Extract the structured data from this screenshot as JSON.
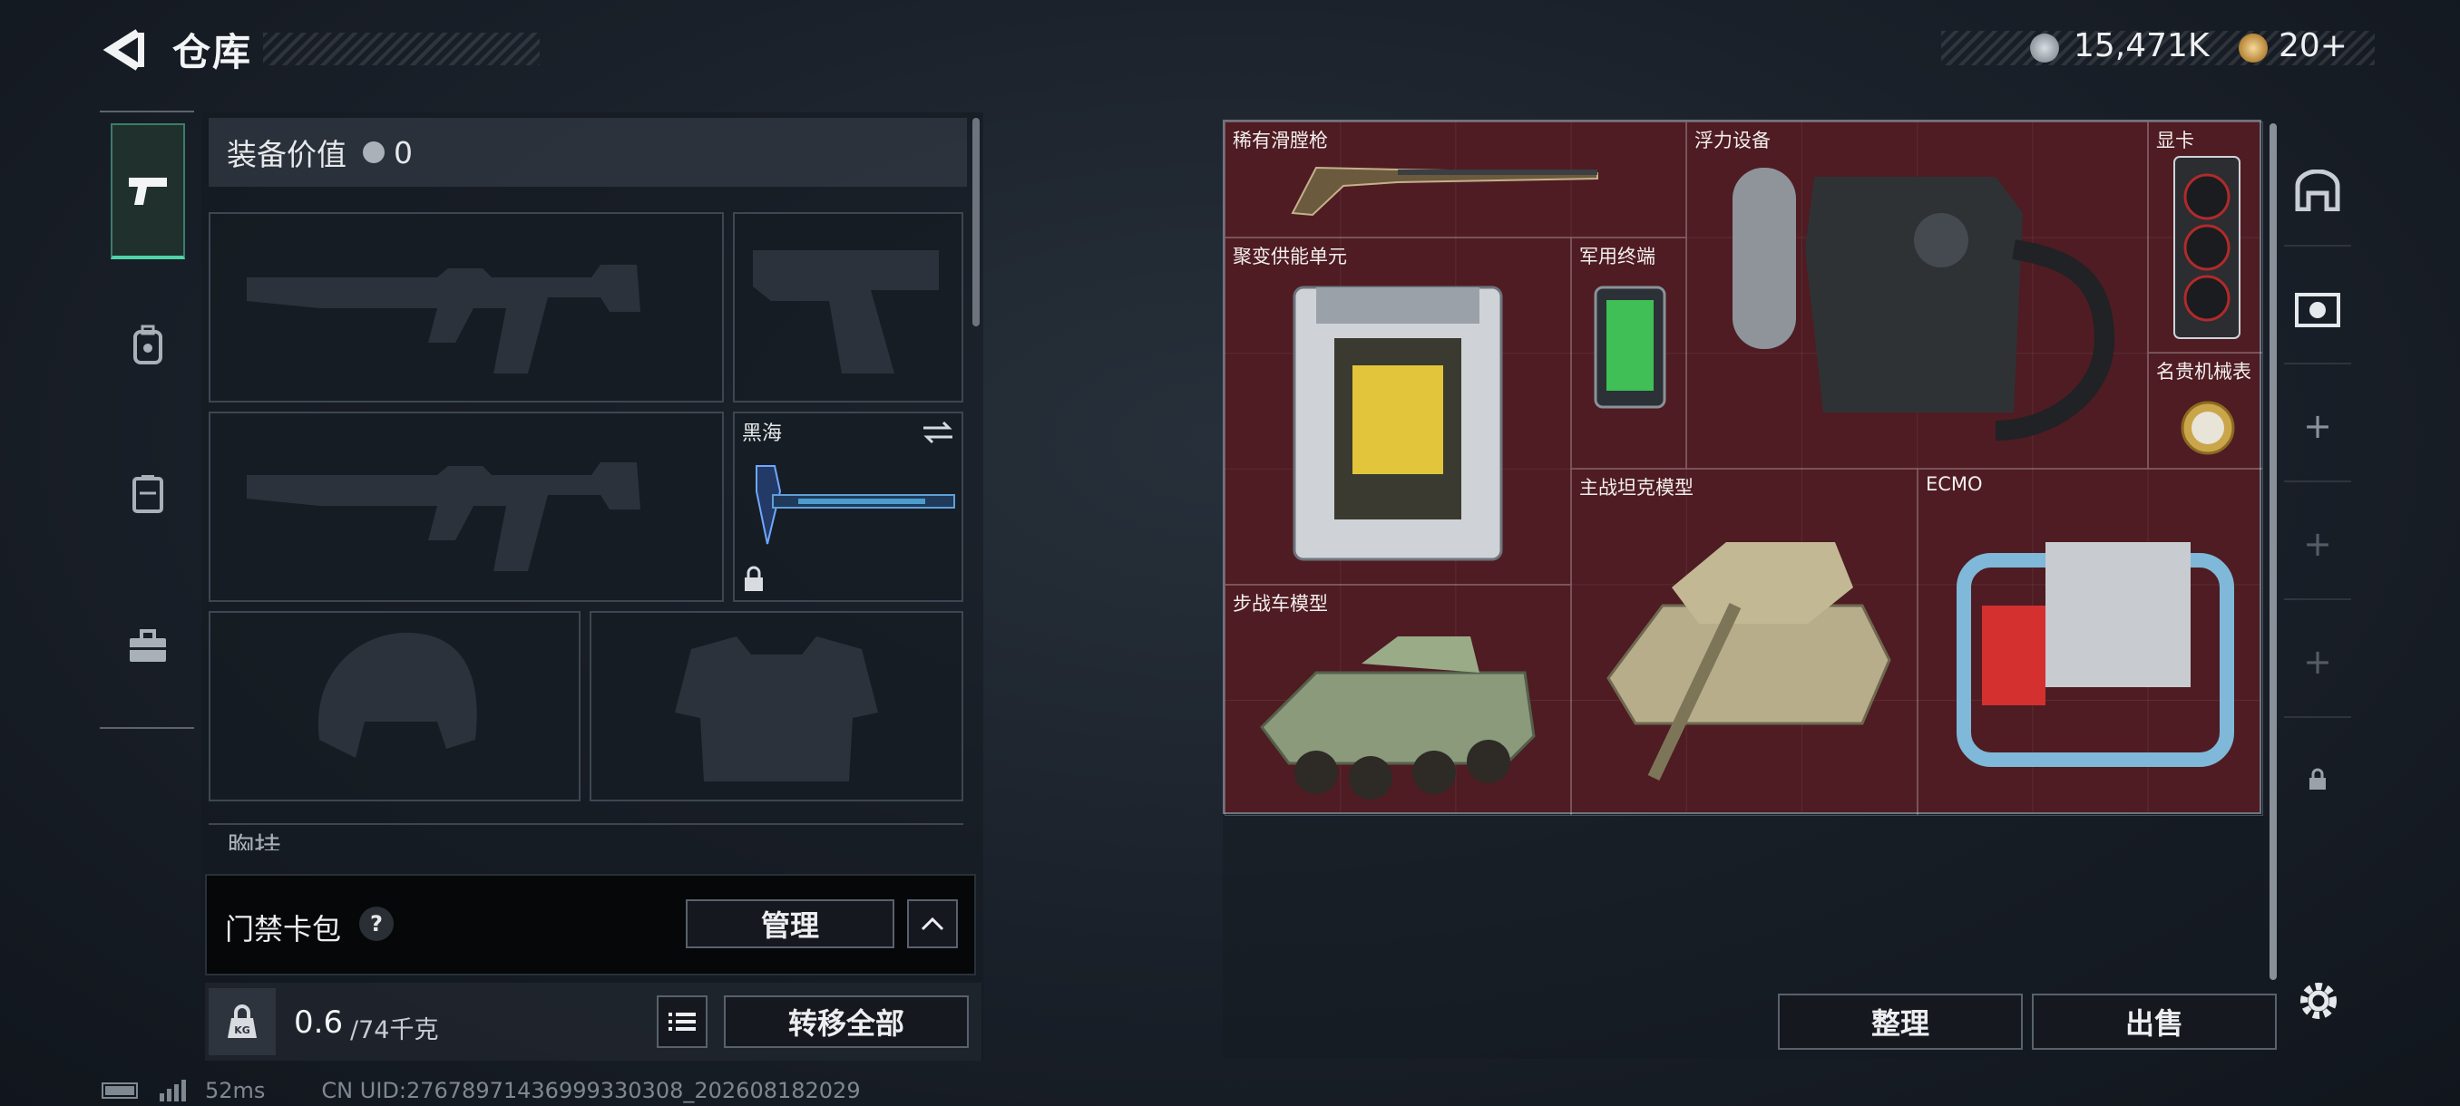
{
  "header": {
    "title": "仓库"
  },
  "currency": {
    "main": "15,471K",
    "tickets": "20+"
  },
  "left_panel": {
    "equipment_value_label": "装备价值",
    "equipment_value": "0",
    "melee_name": "黑海",
    "chest_rig_label": "胸挂",
    "keycard_label": "门禁卡包",
    "help_mark": "?",
    "manage_button": "管理",
    "weight_current": "0.6",
    "weight_max": "/74千克",
    "weight_badge": "KG",
    "transfer_all_button": "转移全部"
  },
  "grid_items": [
    {
      "label": "稀有滑膛枪"
    },
    {
      "label": "浮力设备"
    },
    {
      "label": "显卡"
    },
    {
      "label": "聚变供能单元"
    },
    {
      "label": "军用终端"
    },
    {
      "label": "名贵机械表"
    },
    {
      "label": "主战坦克模型"
    },
    {
      "label": "ECMO"
    },
    {
      "label": "步战车模型"
    }
  ],
  "right_panel": {
    "sort_button": "整理",
    "sell_button": "出售"
  },
  "status": {
    "ping": "52ms",
    "uid": "CN UID:27678971436999330308_202608182029"
  },
  "colors": {
    "grid_bg": "#4e1c22",
    "accent_green": "#4fd3a8",
    "panel_dark": "#060708"
  }
}
